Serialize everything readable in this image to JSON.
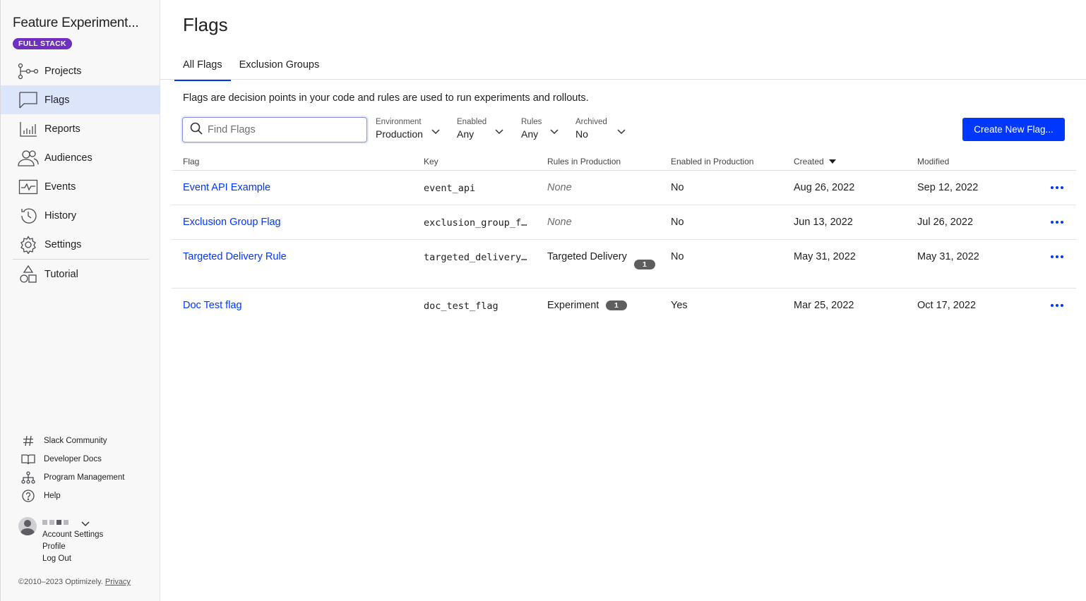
{
  "sidebar": {
    "app_title": "Feature Experiment...",
    "badge": "FULL STACK",
    "nav": [
      {
        "label": "Projects",
        "icon": "projects-icon"
      },
      {
        "label": "Flags",
        "icon": "flag-icon",
        "active": true
      },
      {
        "label": "Reports",
        "icon": "reports-icon"
      },
      {
        "label": "Audiences",
        "icon": "audiences-icon"
      },
      {
        "label": "Events",
        "icon": "events-icon"
      },
      {
        "label": "History",
        "icon": "history-icon"
      },
      {
        "label": "Settings",
        "icon": "settings-icon"
      },
      {
        "label": "Tutorial",
        "icon": "tutorial-icon"
      }
    ],
    "footer_links": [
      {
        "label": "Slack Community",
        "icon": "hash-icon"
      },
      {
        "label": "Developer Docs",
        "icon": "book-icon"
      },
      {
        "label": "Program Management",
        "icon": "hierarchy-icon"
      },
      {
        "label": "Help",
        "icon": "help-icon"
      }
    ],
    "account": {
      "settings": "Account Settings",
      "profile": "Profile",
      "logout": "Log Out"
    },
    "copyright": "©2010–2023 Optimizely.",
    "privacy": "Privacy"
  },
  "main": {
    "title": "Flags",
    "tabs": [
      {
        "label": "All Flags",
        "active": true
      },
      {
        "label": "Exclusion Groups",
        "active": false
      }
    ],
    "description": "Flags are decision points in your code and rules are used to run experiments and rollouts.",
    "search_placeholder": "Find Flags",
    "filters": [
      {
        "label": "Environment",
        "value": "Production"
      },
      {
        "label": "Enabled",
        "value": "Any"
      },
      {
        "label": "Rules",
        "value": "Any"
      },
      {
        "label": "Archived",
        "value": "No"
      }
    ],
    "create_button": "Create New Flag...",
    "columns": [
      "Flag",
      "Key",
      "Rules in Production",
      "Enabled in Production",
      "Created",
      "Modified"
    ],
    "rows": [
      {
        "flag": "Event API Example",
        "key": "event_api",
        "rules": "None",
        "rules_count": "",
        "enabled": "No",
        "created": "Aug 26, 2022",
        "modified": "Sep 12, 2022"
      },
      {
        "flag": "Exclusion Group Flag",
        "key": "exclusion_group_f…",
        "rules": "None",
        "rules_count": "",
        "enabled": "No",
        "created": "Jun 13, 2022",
        "modified": "Jul 26, 2022"
      },
      {
        "flag": "Targeted Delivery Rule",
        "key": "targeted_delivery…",
        "rules": "Targeted Delivery",
        "rules_count": "1",
        "enabled": "No",
        "created": "May 31, 2022",
        "modified": "May 31, 2022"
      },
      {
        "flag": "Doc Test flag",
        "key": "doc_test_flag",
        "rules": "Experiment",
        "rules_count": "1",
        "enabled": "Yes",
        "created": "Mar 25, 2022",
        "modified": "Oct 17, 2022"
      }
    ]
  },
  "colors": {
    "accent": "#0037ff",
    "badge": "#6f2fbf",
    "active_nav": "#dde5fb"
  }
}
